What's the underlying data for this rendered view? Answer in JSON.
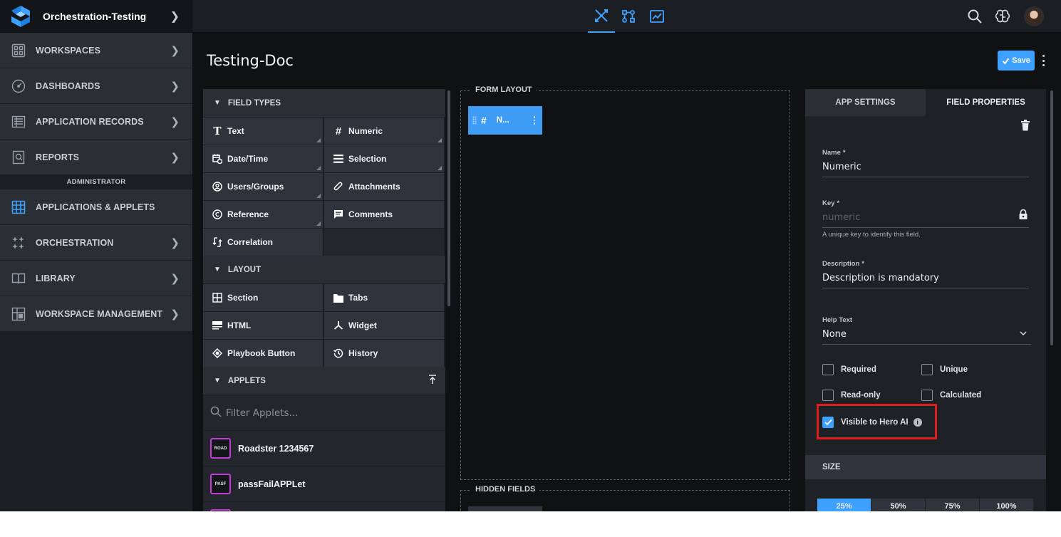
{
  "header": {
    "workspace_name": "Orchestration-Testing",
    "mode_icons": [
      "design-icon",
      "workflow-icon",
      "preview-icon"
    ],
    "active_mode": "design-icon",
    "right_icons": [
      "search-icon",
      "brain-icon",
      "avatar"
    ]
  },
  "sidebar": {
    "items": [
      {
        "label": "WORKSPACES",
        "icon": "grid-icon"
      },
      {
        "label": "DASHBOARDS",
        "icon": "gauge-icon"
      },
      {
        "label": "APPLICATION RECORDS",
        "icon": "records-icon"
      },
      {
        "label": "REPORTS",
        "icon": "report-icon"
      },
      {
        "label": "APPLICATIONS & APPLETS",
        "icon": "apps-icon"
      },
      {
        "label": "ORCHESTRATION",
        "icon": "sparkle-icon"
      },
      {
        "label": "LIBRARY",
        "icon": "book-icon"
      },
      {
        "label": "WORKSPACE MANAGEMENT",
        "icon": "manage-icon"
      }
    ],
    "section_label": "ADMINISTRATOR"
  },
  "page": {
    "title": "Testing-Doc",
    "save_label": "Save"
  },
  "palette": {
    "field_types_title": "FIELD TYPES",
    "field_types": [
      {
        "label": "Text",
        "icon": "T"
      },
      {
        "label": "Numeric",
        "icon": "#"
      },
      {
        "label": "Date/Time",
        "icon": "📅"
      },
      {
        "label": "Selection",
        "icon": "☰"
      },
      {
        "label": "Users/Groups",
        "icon": "user"
      },
      {
        "label": "Attachments",
        "icon": "clip"
      },
      {
        "label": "Reference",
        "icon": "ref"
      },
      {
        "label": "Comments",
        "icon": "comment"
      },
      {
        "label": "Correlation",
        "icon": "corr"
      }
    ],
    "layout_title": "LAYOUT",
    "layout": [
      {
        "label": "Section"
      },
      {
        "label": "Tabs"
      },
      {
        "label": "HTML"
      },
      {
        "label": "Widget"
      },
      {
        "label": "Playbook Button"
      },
      {
        "label": "History"
      }
    ],
    "applets_title": "APPLETS",
    "filter_placeholder": "Filter Applets...",
    "applets": [
      {
        "badge": "ROAD",
        "label": "Roadster 1234567"
      },
      {
        "badge": "PASF",
        "label": "passFailAPPLet"
      }
    ]
  },
  "form_layout": {
    "title": "FORM LAYOUT",
    "field_chip_label": "N...",
    "hidden_title": "HIDDEN FIELDS"
  },
  "properties": {
    "tabs": [
      "APP SETTINGS",
      "FIELD PROPERTIES"
    ],
    "active_tab": "FIELD PROPERTIES",
    "name_label": "Name",
    "name_value": "Numeric",
    "key_label": "Key",
    "key_value": "numeric",
    "key_hint": "A unique key to identify this field.",
    "description_label": "Description",
    "description_value": "Description is mandatory",
    "help_text_label": "Help Text",
    "help_text_value": "None",
    "required_mark": "*",
    "checkboxes": {
      "required": {
        "label": "Required",
        "checked": false
      },
      "unique": {
        "label": "Unique",
        "checked": false
      },
      "read_only": {
        "label": "Read-only",
        "checked": false
      },
      "calculated": {
        "label": "Calculated",
        "checked": false
      },
      "visible_hero_ai": {
        "label": "Visible to Hero AI",
        "checked": true
      }
    },
    "size_title": "SIZE",
    "size_options": [
      "25%",
      "50%",
      "75%",
      "100%"
    ],
    "size_selected": "25%"
  },
  "colors": {
    "accent": "#3ea1ff",
    "highlight": "#e01c1c",
    "applet_badge": "#c23bd9"
  }
}
